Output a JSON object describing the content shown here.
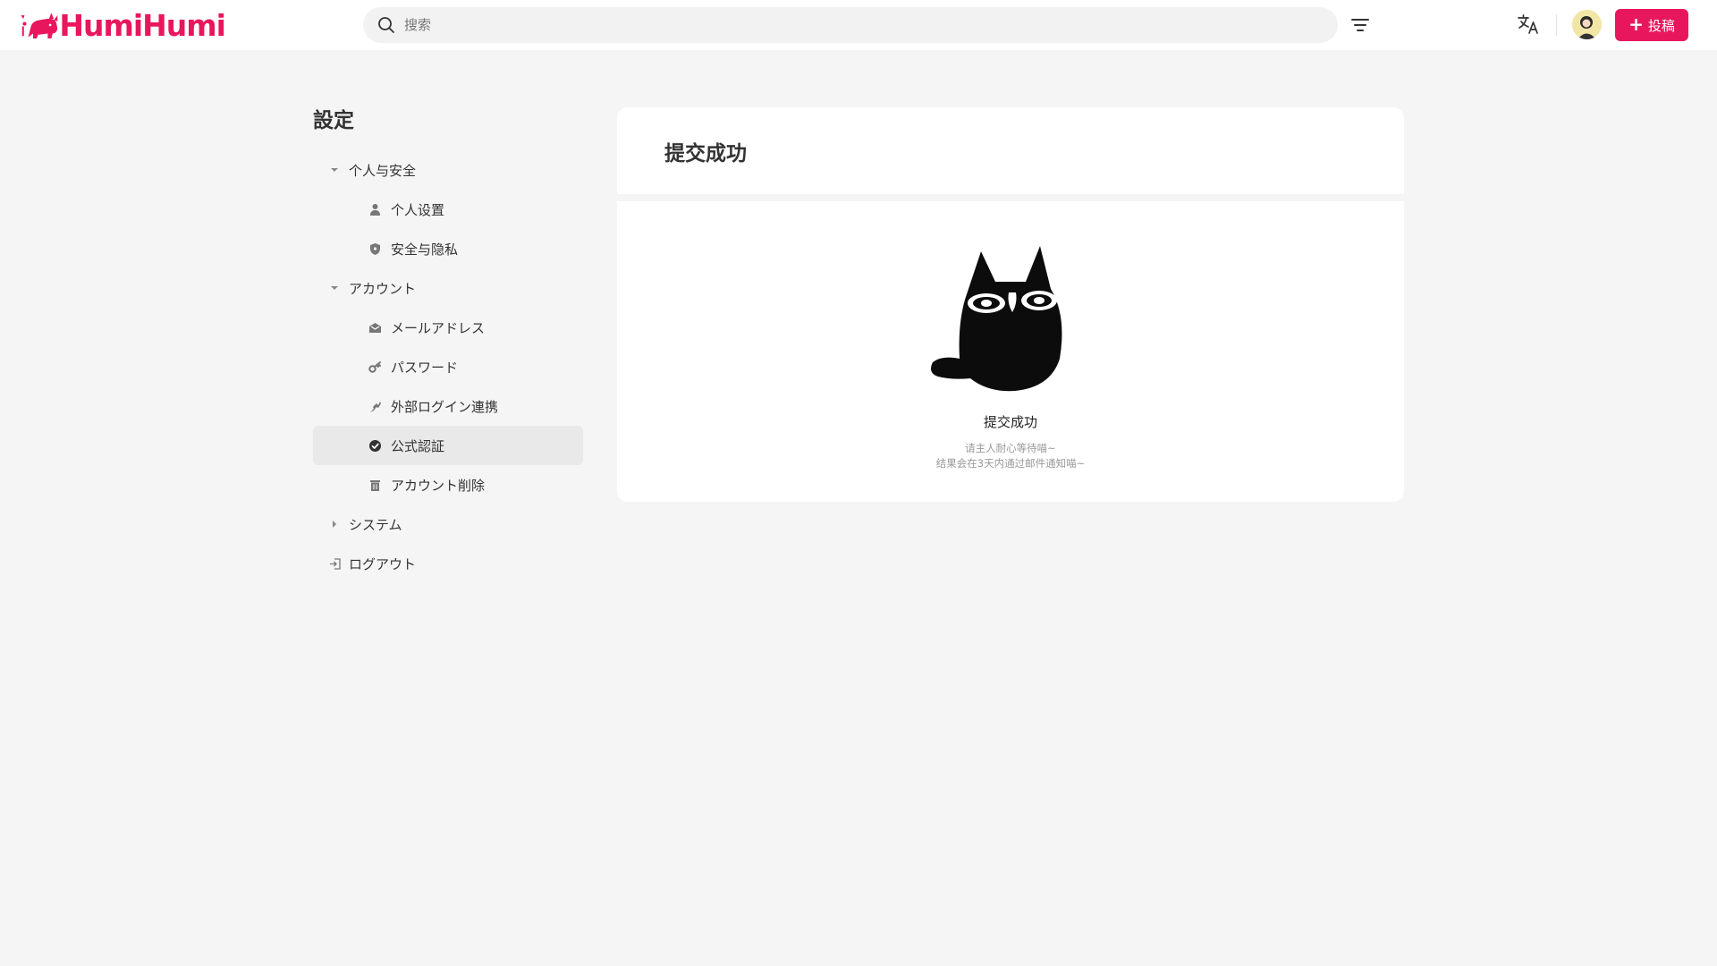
{
  "header": {
    "logo_text": "HumiHumi",
    "search_placeholder": "搜索",
    "post_button_label": "投稿"
  },
  "sidebar": {
    "title": "設定",
    "groups": [
      {
        "label": "个人与安全",
        "items": [
          {
            "label": "个人设置",
            "icon": "person-icon"
          },
          {
            "label": "安全与隐私",
            "icon": "shield-icon"
          }
        ]
      },
      {
        "label": "アカウント",
        "items": [
          {
            "label": "メールアドレス",
            "icon": "mail-icon"
          },
          {
            "label": "パスワード",
            "icon": "key-icon"
          },
          {
            "label": "外部ログイン連携",
            "icon": "link-icon"
          },
          {
            "label": "公式認証",
            "icon": "verified-icon",
            "active": true
          },
          {
            "label": "アカウント削除",
            "icon": "trash-icon"
          }
        ]
      },
      {
        "label": "システム",
        "items": []
      }
    ],
    "logout_label": "ログアウト"
  },
  "main": {
    "card_title": "提交成功",
    "success_title": "提交成功",
    "success_line1": "请主人耐心等待喵~",
    "success_line2": "结果会在3天内通过邮件通知喵~"
  },
  "colors": {
    "brand": "#e8175d",
    "background": "#f5f5f5",
    "active_item": "#e9e9e9"
  }
}
